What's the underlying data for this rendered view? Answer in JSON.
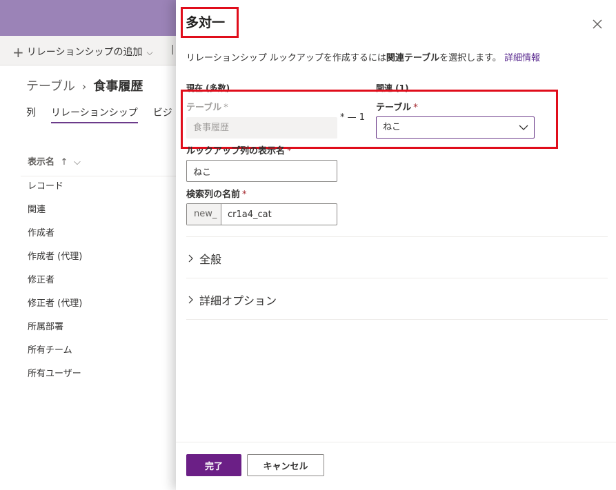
{
  "background": {
    "command_bar": {
      "add_relationship_label": "リレーションシップの追加",
      "plus_icon": "plus-icon",
      "chevron_icon": "chevron-down-icon"
    },
    "breadcrumb": {
      "root": "テーブル",
      "current": "食事履歴"
    },
    "tabs": [
      {
        "label": "列"
      },
      {
        "label": "リレーションシップ",
        "active": true
      },
      {
        "label": "ビジ"
      }
    ],
    "column_header": {
      "label": "表示名",
      "sort_arrow": "↑",
      "chevron": "⌵"
    },
    "list_items": [
      "レコード",
      "関連",
      "作成者",
      "作成者 (代理)",
      "修正者",
      "修正者 (代理)",
      "所属部署",
      "所有チーム",
      "所有ユーザー"
    ]
  },
  "dialog": {
    "title": "多対一",
    "close_icon": "close-icon",
    "description": {
      "prefix": "リレーションシップ ルックアップを作成するには",
      "bold": "関連テーブル",
      "suffix": "を選択します。",
      "link": "詳細情報"
    },
    "current_section": {
      "label": "現在 (多数)",
      "table_label": "テーブル",
      "required_mark": "*",
      "table_value": "食事履歴"
    },
    "connector": "* — 1",
    "related_section": {
      "label": "関連 (1)",
      "table_label": "テーブル",
      "required_mark": "*",
      "table_value": "ねこ"
    },
    "lookup_display_name": {
      "label": "ルックアップ列の表示名",
      "required_mark": "*",
      "value": "ねこ"
    },
    "lookup_column_name": {
      "label": "検索列の名前",
      "required_mark": "*",
      "prefix": "new_",
      "value": "cr1a4_cat"
    },
    "sections": [
      {
        "label": "全般"
      },
      {
        "label": "詳細オプション"
      }
    ],
    "footer": {
      "done_label": "完了",
      "cancel_label": "キャンセル"
    },
    "colors": {
      "primary": "#6b1f86",
      "highlight": "#e00d1b",
      "link": "#5c2d91"
    }
  }
}
